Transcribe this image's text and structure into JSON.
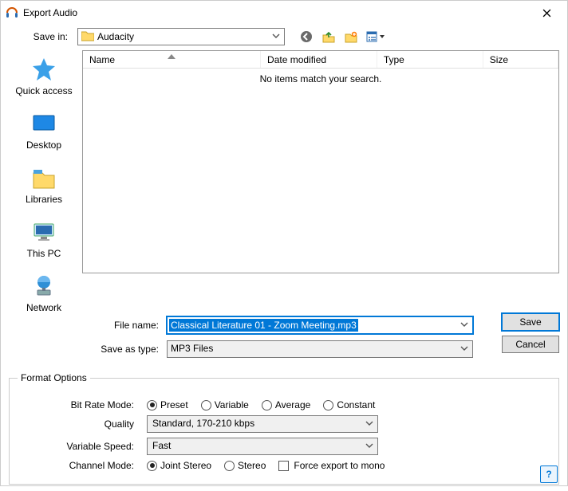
{
  "window": {
    "title": "Export Audio"
  },
  "savein": {
    "label": "Save in:",
    "value": "Audacity"
  },
  "places": {
    "quick_access": "Quick access",
    "desktop": "Desktop",
    "libraries": "Libraries",
    "this_pc": "This PC",
    "network": "Network"
  },
  "columns": {
    "name": "Name",
    "date": "Date modified",
    "type": "Type",
    "size": "Size"
  },
  "list": {
    "empty_text": "No items match your search."
  },
  "filename": {
    "label": "File name:",
    "value": "Classical Literature 01 - Zoom Meeting.mp3"
  },
  "savetype": {
    "label": "Save as type:",
    "value": "MP3 Files"
  },
  "buttons": {
    "save": "Save",
    "cancel": "Cancel"
  },
  "format": {
    "legend": "Format Options",
    "bitrate_label": "Bit Rate Mode:",
    "bitrate_options": {
      "preset": "Preset",
      "variable": "Variable",
      "average": "Average",
      "constant": "Constant"
    },
    "bitrate_selected": "preset",
    "quality_label": "Quality",
    "quality_value": "Standard, 170-210 kbps",
    "varspeed_label": "Variable Speed:",
    "varspeed_value": "Fast",
    "channel_label": "Channel Mode:",
    "channel_options": {
      "joint": "Joint Stereo",
      "stereo": "Stereo"
    },
    "channel_selected": "joint",
    "force_mono": "Force export to mono"
  }
}
